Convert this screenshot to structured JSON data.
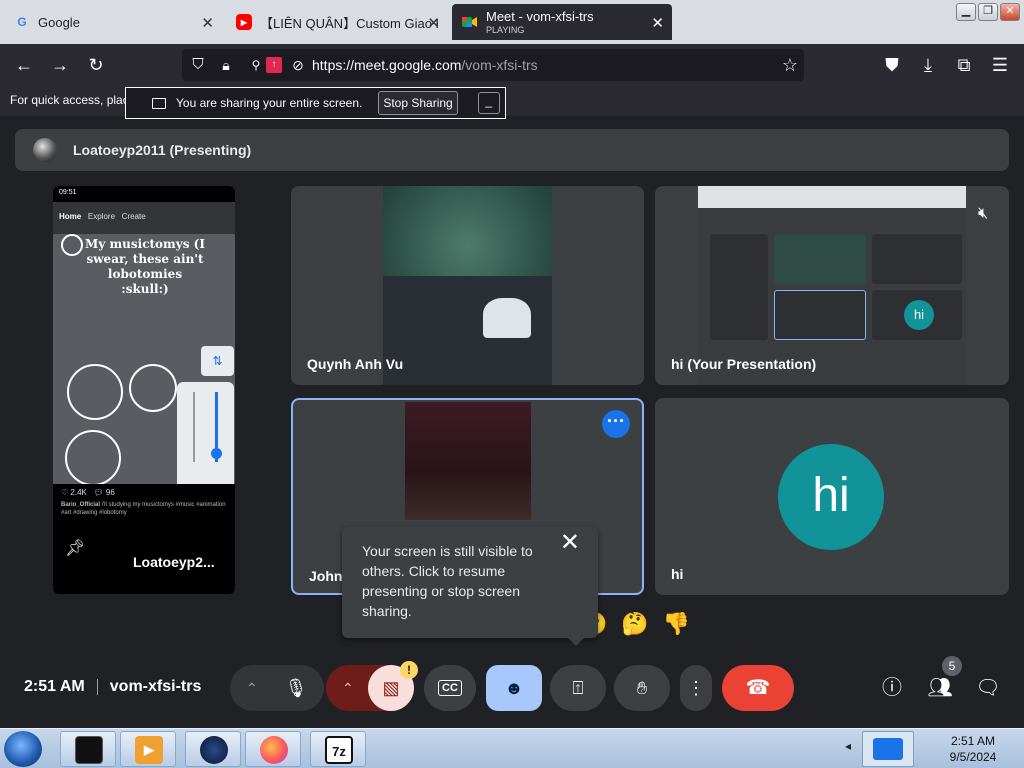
{
  "browser": {
    "tabs": [
      {
        "title": "Google",
        "favicon": "G"
      },
      {
        "title": "【LIÊN QUÂN】Custom Giao H",
        "favicon": "▶"
      },
      {
        "title": "Meet - vom-xfsi-trs",
        "status": "PLAYING"
      }
    ],
    "url_prefix": "https://meet.google.com",
    "url_path": "/vom-xfsi-trs",
    "bookmarks_hint": "For quick access, plac"
  },
  "share_bar": {
    "message": "You are sharing your entire screen.",
    "stop_label": "Stop Sharing",
    "minimize_label": "_"
  },
  "presenter": {
    "name": "Loatoeyp2011 (Presenting)"
  },
  "phone_screen": {
    "time": "09:51",
    "nav_home": "Home",
    "nav_explore": "Explore",
    "nav_create": "Create",
    "post_title": "My musictomys (I swear, these ain't lobotomies :skull:)",
    "likes": "2.4K",
    "comments": "96",
    "author": "Bario_Official",
    "caption": "i'll studying my musictomys #music #animation #art #drawing #lobotomy",
    "tile_label": "Loatoeyp2..."
  },
  "participants": [
    {
      "name": "Quynh Anh Vu"
    },
    {
      "name": "hi (Your Presentation)"
    },
    {
      "name": "John"
    },
    {
      "name": "hi",
      "avatar_letter": "hi"
    }
  ],
  "nested_avatar": "hi",
  "tooltip": {
    "text": "Your screen is still visible to others. Click to resume presenting or stop screen sharing.",
    "close": "✕"
  },
  "reactions": [
    "😮",
    "🤔",
    "👎"
  ],
  "meeting": {
    "time": "2:51 AM",
    "code": "vom-xfsi-trs"
  },
  "controls": {
    "captions_label": "CC",
    "participants_count": "5",
    "camera_warning": "!"
  },
  "taskbar": {
    "time": "2:51 AM",
    "date": "9/5/2024",
    "apps": [
      "cmd",
      "media",
      "night",
      "firefox",
      "7z"
    ]
  },
  "colors": {
    "meet_bg": "#202124",
    "tile_bg": "#3c4043",
    "accent_blue": "#1a73e8",
    "avatar_teal": "#12939a",
    "end_call_red": "#ea4335"
  }
}
